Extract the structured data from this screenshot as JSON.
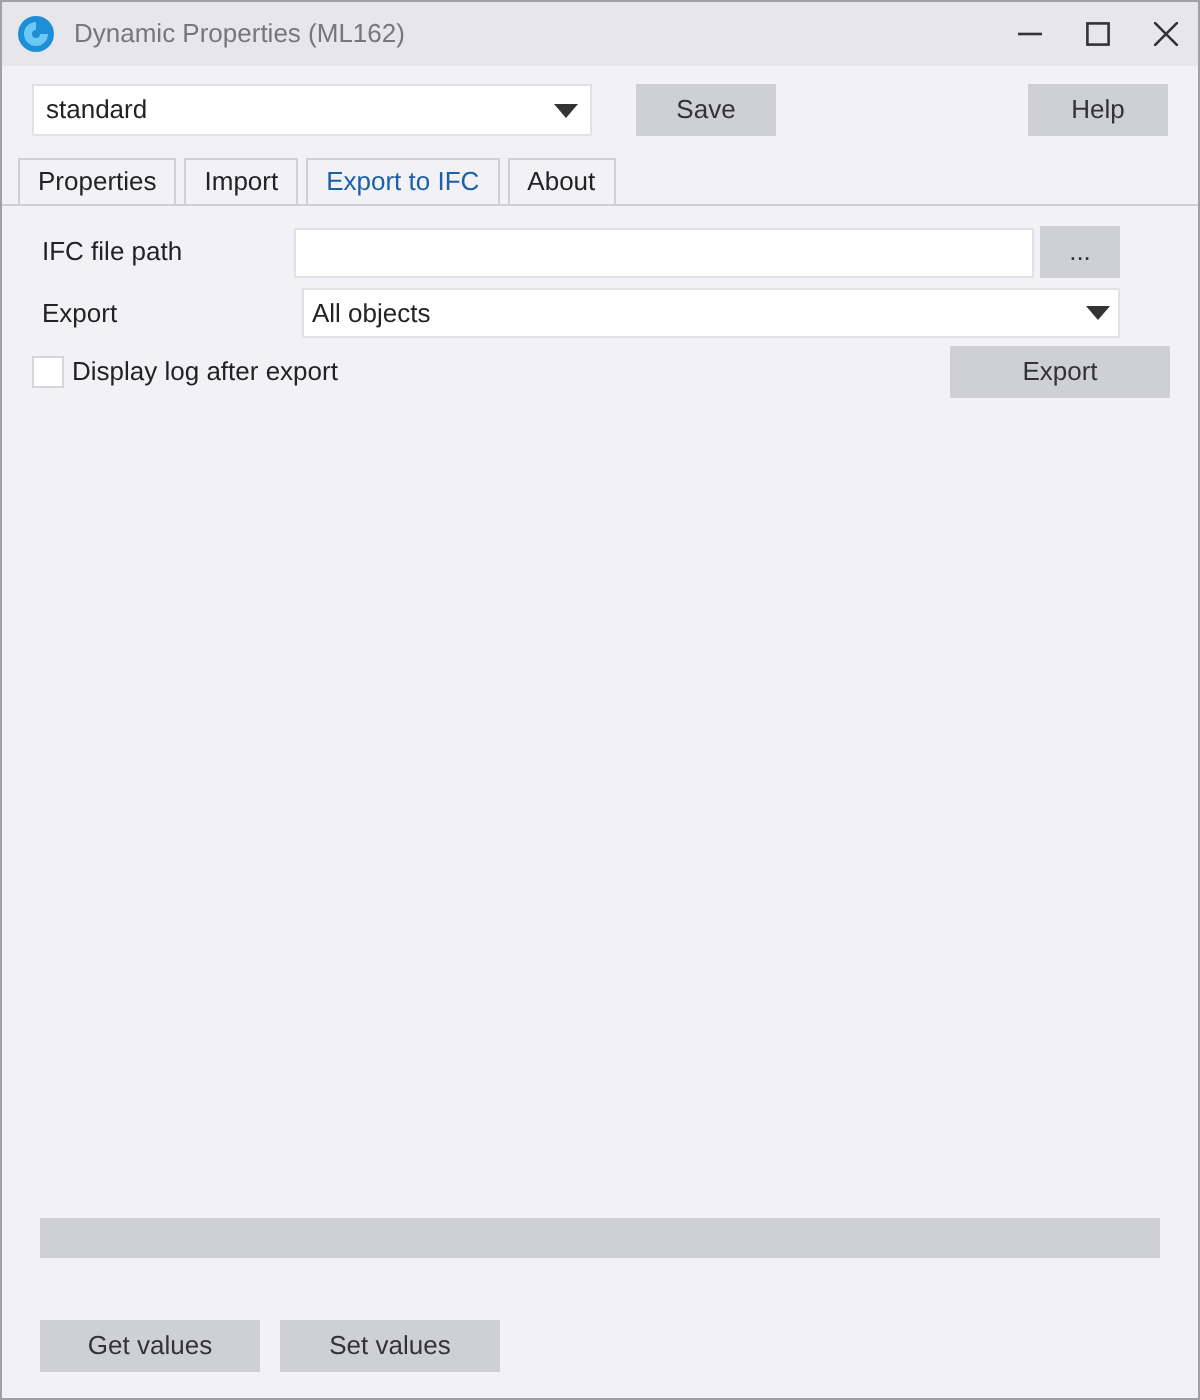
{
  "window": {
    "title": "Dynamic Properties (ML162)"
  },
  "profile": {
    "value": "standard"
  },
  "buttons": {
    "save": "Save",
    "help": "Help",
    "browse": "...",
    "export": "Export",
    "get": "Get values",
    "set": "Set values"
  },
  "tabs": [
    {
      "label": "Properties",
      "selected": false
    },
    {
      "label": "Import",
      "selected": false
    },
    {
      "label": "Export to IFC",
      "selected": true
    },
    {
      "label": "About",
      "selected": false
    }
  ],
  "ifc_path": {
    "label": "IFC file path"
  },
  "export_select": {
    "label": "Export",
    "value": "All objects"
  },
  "display_log": {
    "label": "Display log after export",
    "checked": false
  },
  "progress": {
    "level": 0
  }
}
